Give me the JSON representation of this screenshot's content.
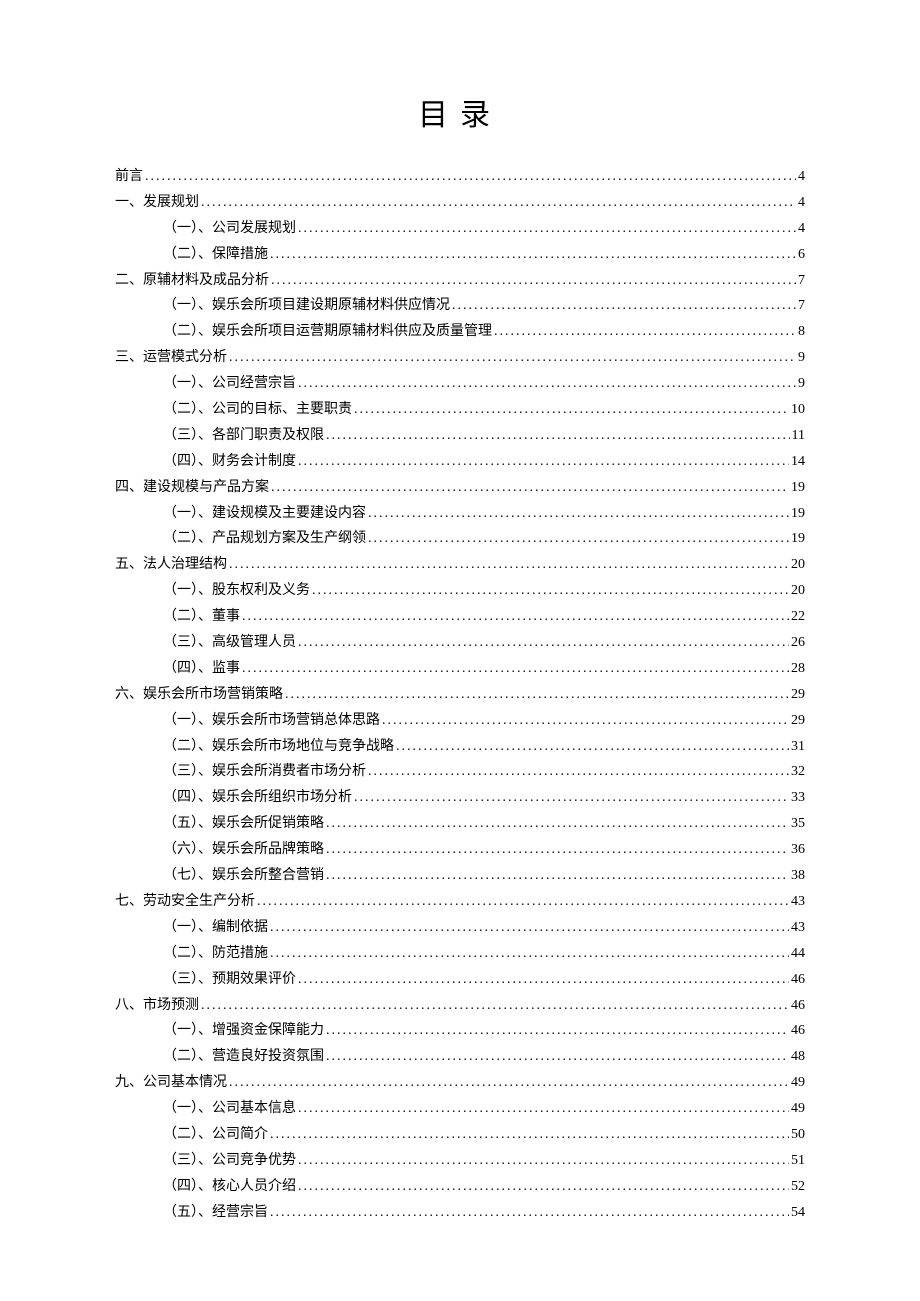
{
  "title": "目录",
  "entries": [
    {
      "level": 1,
      "label": "前言",
      "page": "4"
    },
    {
      "level": 1,
      "label": "一、发展规划",
      "page": "4"
    },
    {
      "level": 2,
      "label": "（一）、公司发展规划",
      "page": "4"
    },
    {
      "level": 2,
      "label": "（二）、保障措施",
      "page": "6"
    },
    {
      "level": 1,
      "label": "二、原辅材料及成品分析",
      "page": "7"
    },
    {
      "level": 2,
      "label": "（一）、娱乐会所项目建设期原辅材料供应情况",
      "page": "7"
    },
    {
      "level": 2,
      "label": "（二）、娱乐会所项目运营期原辅材料供应及质量管理",
      "page": "8"
    },
    {
      "level": 1,
      "label": "三、运营模式分析",
      "page": "9"
    },
    {
      "level": 2,
      "label": "（一）、公司经营宗旨",
      "page": "9"
    },
    {
      "level": 2,
      "label": "（二）、公司的目标、主要职责",
      "page": "10"
    },
    {
      "level": 2,
      "label": "（三）、各部门职责及权限",
      "page": "11"
    },
    {
      "level": 2,
      "label": "（四）、财务会计制度",
      "page": "14"
    },
    {
      "level": 1,
      "label": "四、建设规模与产品方案",
      "page": "19"
    },
    {
      "level": 2,
      "label": "（一）、建设规模及主要建设内容",
      "page": "19"
    },
    {
      "level": 2,
      "label": "（二）、产品规划方案及生产纲领",
      "page": "19"
    },
    {
      "level": 1,
      "label": "五、法人治理结构",
      "page": "20"
    },
    {
      "level": 2,
      "label": "（一）、股东权利及义务",
      "page": "20"
    },
    {
      "level": 2,
      "label": "（二）、董事",
      "page": "22"
    },
    {
      "level": 2,
      "label": "（三）、高级管理人员",
      "page": "26"
    },
    {
      "level": 2,
      "label": "（四）、监事",
      "page": "28"
    },
    {
      "level": 1,
      "label": "六、娱乐会所市场营销策略",
      "page": "29"
    },
    {
      "level": 2,
      "label": "（一）、娱乐会所市场营销总体思路",
      "page": "29"
    },
    {
      "level": 2,
      "label": "（二）、娱乐会所市场地位与竞争战略",
      "page": "31"
    },
    {
      "level": 2,
      "label": "（三）、娱乐会所消费者市场分析",
      "page": "32"
    },
    {
      "level": 2,
      "label": "（四）、娱乐会所组织市场分析",
      "page": "33"
    },
    {
      "level": 2,
      "label": "（五）、娱乐会所促销策略",
      "page": "35"
    },
    {
      "level": 2,
      "label": "（六）、娱乐会所品牌策略",
      "page": "36"
    },
    {
      "level": 2,
      "label": "（七）、娱乐会所整合营销",
      "page": "38"
    },
    {
      "level": 1,
      "label": "七、劳动安全生产分析",
      "page": "43"
    },
    {
      "level": 2,
      "label": "（一）、编制依据",
      "page": "43"
    },
    {
      "level": 2,
      "label": "（二）、防范措施",
      "page": "44"
    },
    {
      "level": 2,
      "label": "（三）、预期效果评价",
      "page": "46"
    },
    {
      "level": 1,
      "label": "八、市场预测",
      "page": "46"
    },
    {
      "level": 2,
      "label": "（一）、增强资金保障能力",
      "page": "46"
    },
    {
      "level": 2,
      "label": "（二）、营造良好投资氛围",
      "page": "48"
    },
    {
      "level": 1,
      "label": "九、公司基本情况",
      "page": "49"
    },
    {
      "level": 2,
      "label": "（一）、公司基本信息",
      "page": "49"
    },
    {
      "level": 2,
      "label": "（二）、公司简介",
      "page": "50"
    },
    {
      "level": 2,
      "label": "（三）、公司竞争优势",
      "page": "51"
    },
    {
      "level": 2,
      "label": "（四）、核心人员介绍",
      "page": "52"
    },
    {
      "level": 2,
      "label": "（五）、经营宗旨",
      "page": "54"
    }
  ]
}
